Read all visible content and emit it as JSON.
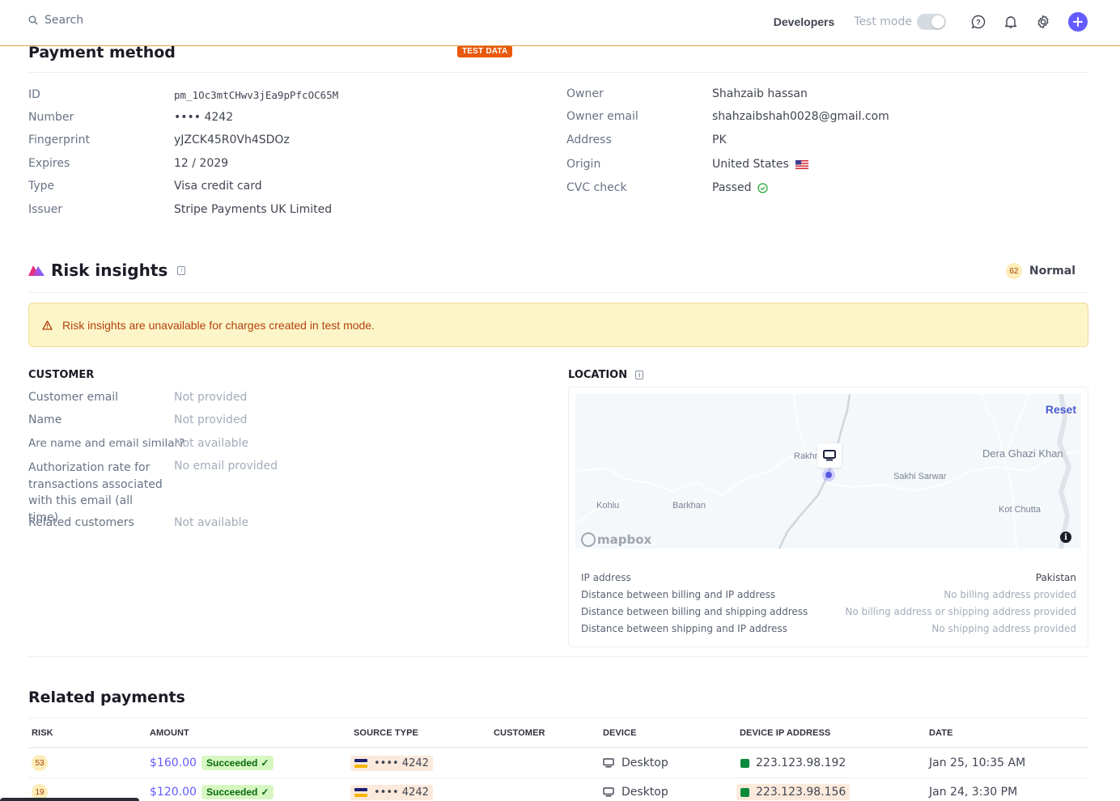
{
  "topbar": {
    "search_placeholder": "Search",
    "developers_label": "Developers",
    "test_mode_label": "Test mode",
    "test_mode_on": false,
    "icons": [
      "help-icon",
      "bell-icon",
      "gear-icon",
      "plus-icon"
    ]
  },
  "payment_method": {
    "title": "Payment method",
    "badge": "TEST DATA",
    "left": [
      {
        "label": "ID",
        "value": "pm_1Oc3mtCHwv3jEa9pPfcOC65M"
      },
      {
        "label": "Number",
        "value": "•••• 4242"
      },
      {
        "label": "Fingerprint",
        "value": "yJZCK45R0Vh4SDOz"
      },
      {
        "label": "Expires",
        "value": "12 / 2029"
      },
      {
        "label": "Type",
        "value": "Visa credit card"
      },
      {
        "label": "Issuer",
        "value": "Stripe Payments UK Limited"
      }
    ],
    "right": [
      {
        "label": "Owner",
        "value": "Shahzaib hassan"
      },
      {
        "label": "Owner email",
        "value": "shahzaibshah0028@gmail.com"
      },
      {
        "label": "Address",
        "value": "PK"
      },
      {
        "label": "Origin",
        "value": "United States",
        "flag": "us-flag-icon"
      },
      {
        "label": "CVC check",
        "value": "Passed",
        "status_icon": "check-circle-icon"
      }
    ]
  },
  "risk_insights": {
    "title": "Risk insights",
    "score": "62",
    "level": "Normal",
    "alert": "Risk insights are unavailable for charges created in test mode.",
    "customer": {
      "heading": "CUSTOMER",
      "rows": [
        {
          "label": "Customer email",
          "value": "Not provided"
        },
        {
          "label": "Name",
          "value": "Not provided"
        },
        {
          "label": "Are name and email similar?",
          "value": "Not available"
        },
        {
          "label": "Authorization rate for transactions associated with this email (all time)",
          "value": "No email provided"
        },
        {
          "label": "Related customers",
          "value": "Not available"
        }
      ]
    },
    "location": {
      "heading": "LOCATION",
      "map": {
        "reset_label": "Reset",
        "attribution": "mapbox",
        "places": [
          "Rakhni",
          "Dera Ghazi Khan",
          "Sakhi Sarwar",
          "Kohlu",
          "Barkhan",
          "Kot Chutta"
        ]
      },
      "rows": [
        {
          "label": "IP address",
          "value": "Pakistan"
        },
        {
          "label": "Distance between billing and IP address",
          "value": "No billing address provided"
        },
        {
          "label": "Distance between billing and shipping address",
          "value": "No billing address or shipping address provided"
        },
        {
          "label": "Distance between shipping and IP address",
          "value": "No shipping address provided"
        }
      ]
    }
  },
  "related_payments": {
    "title": "Related payments",
    "columns": [
      "RISK",
      "AMOUNT",
      "SOURCE TYPE",
      "CUSTOMER",
      "DEVICE",
      "DEVICE IP ADDRESS",
      "DATE"
    ],
    "rows": [
      {
        "risk": "53",
        "amount": "$160.00",
        "status": "Succeeded",
        "source": "•••• 4242",
        "customer": "",
        "device": "Desktop",
        "ip": "223.123.98.192",
        "date": "Jan 25, 10:35 AM"
      },
      {
        "risk": "19",
        "amount": "$120.00",
        "status": "Succeeded",
        "source": "•••• 4242",
        "customer": "",
        "device": "Desktop",
        "ip": "223.123.98.156",
        "date": "Jan 24, 3:30 PM"
      }
    ]
  }
}
